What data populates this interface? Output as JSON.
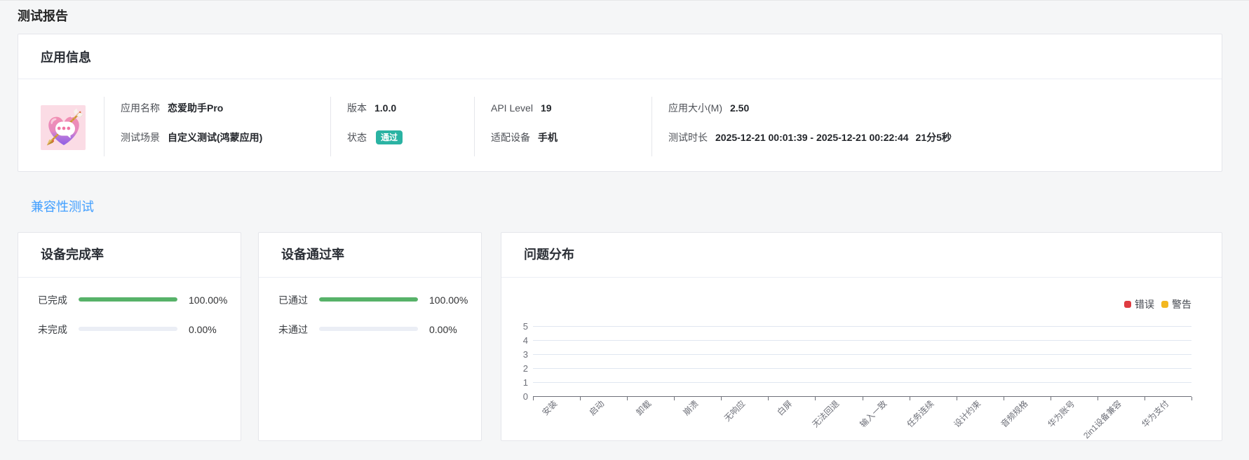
{
  "page_title": "测试报告",
  "info_card": {
    "title": "应用信息",
    "fields": {
      "app_name_label": "应用名称",
      "app_name": "恋爱助手Pro",
      "scenario_label": "测试场景",
      "scenario": "自定义测试(鸿蒙应用)",
      "version_label": "版本",
      "version": "1.0.0",
      "status_label": "状态",
      "status": "通过",
      "api_level_label": "API Level",
      "api_level": "19",
      "device_label": "适配设备",
      "device": "手机",
      "app_size_label": "应用大小(M)",
      "app_size": "2.50",
      "duration_label": "测试时长",
      "duration_range": "2025-12-21 00:01:39 - 2025-12-21 00:22:44",
      "duration_total": "21分5秒"
    },
    "status_color": "#2ab3a3"
  },
  "section_link": "兼容性测试",
  "completion_card": {
    "title": "设备完成率",
    "rows": [
      {
        "label": "已完成",
        "value": "100.00%",
        "percent": 100
      },
      {
        "label": "未完成",
        "value": "0.00%",
        "percent": 0
      }
    ]
  },
  "pass_card": {
    "title": "设备通过率",
    "rows": [
      {
        "label": "已通过",
        "value": "100.00%",
        "percent": 100
      },
      {
        "label": "未通过",
        "value": "0.00%",
        "percent": 0
      }
    ]
  },
  "progress_colors": {
    "fill": "#57b269",
    "track": "#ebeef5"
  },
  "chart_card_title": "问题分布",
  "chart_data": {
    "type": "bar",
    "title": "问题分布",
    "categories": [
      "安装",
      "启动",
      "卸载",
      "崩溃",
      "无响应",
      "白屏",
      "无法回退",
      "输入一致",
      "任务连续",
      "设计约束",
      "音频规格",
      "华为账号",
      "2in1设备兼容",
      "华为支付"
    ],
    "series": [
      {
        "name": "错误",
        "color": "#df3b41",
        "values": [
          0,
          0,
          0,
          0,
          0,
          0,
          0,
          0,
          0,
          0,
          0,
          0,
          0,
          0
        ]
      },
      {
        "name": "警告",
        "color": "#f3b71f",
        "values": [
          0,
          0,
          0,
          0,
          0,
          0,
          0,
          0,
          0,
          0,
          0,
          0,
          0,
          0
        ]
      }
    ],
    "ylim": [
      0,
      5
    ],
    "yticks": [
      0,
      1,
      2,
      3,
      4,
      5
    ],
    "xlabel": "",
    "ylabel": "",
    "grid": true,
    "legend_position": "top-right"
  }
}
